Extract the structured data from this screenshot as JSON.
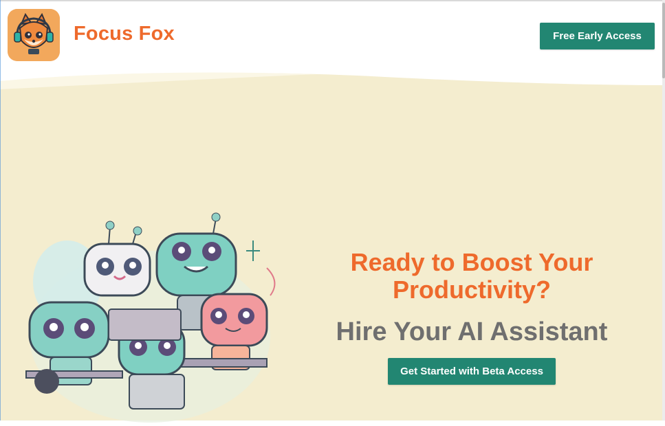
{
  "header": {
    "brand_name": "Focus Fox",
    "early_access_label": "Free Early Access",
    "logo_icon": "fox-with-headphones-icon"
  },
  "hero": {
    "headline": "Ready to Boost Your Productivity?",
    "subheadline": "Hire Your AI Assistant",
    "cta_label": "Get Started with Beta Access",
    "illustration": "robots-working-illustration"
  },
  "colors": {
    "brand_orange": "#ee6a2c",
    "button_teal": "#228672",
    "hero_background": "#f4edcf",
    "subhead_gray": "#6f6f6f"
  }
}
